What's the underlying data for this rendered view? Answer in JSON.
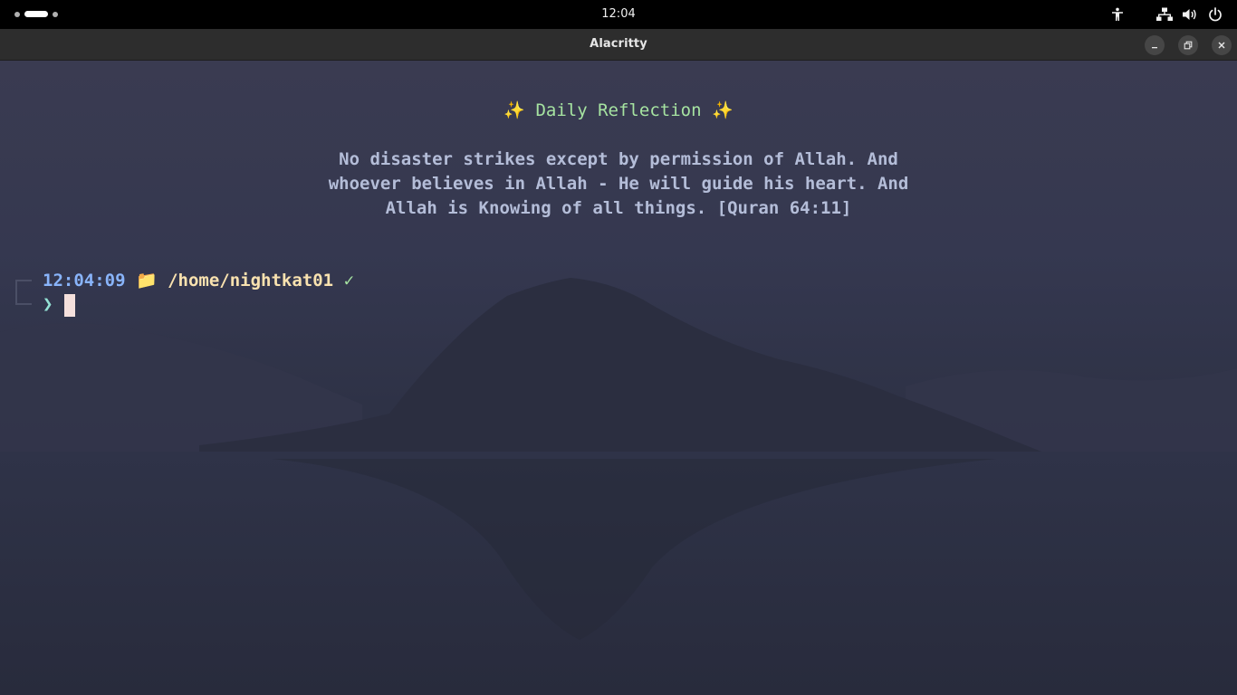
{
  "topbar": {
    "clock": "12:04",
    "workspace_count": 3,
    "active_workspace": 2,
    "tray_icons": [
      "accessibility-icon",
      "network-wired-icon",
      "volume-icon",
      "power-icon"
    ]
  },
  "window": {
    "title": "Alacritty",
    "controls": [
      "minimize-icon",
      "maximize-icon",
      "close-icon"
    ]
  },
  "terminal": {
    "reflection": {
      "spark_left": "✨",
      "title": "Daily Reflection",
      "spark_right": "✨",
      "quote_lines": [
        "No disaster strikes except by permission of Allah. And",
        "whoever believes in Allah - He will guide his heart. And",
        "Allah is Knowing of all things. [Quran 64:11]"
      ]
    },
    "prompt": {
      "time": "12:04:09",
      "folder_icon": "📁",
      "path": "/home/nightkat01",
      "status": "✓",
      "symbol": "❯"
    }
  },
  "colors": {
    "reflection_title": "#a6e3a1",
    "quote_text": "#b4bdd8",
    "prompt_time": "#89b4fa",
    "prompt_path": "#f9e2af",
    "prompt_check": "#a6e3a1",
    "prompt_symbol": "#94e2d5",
    "cursor": "#f5e0dc"
  }
}
